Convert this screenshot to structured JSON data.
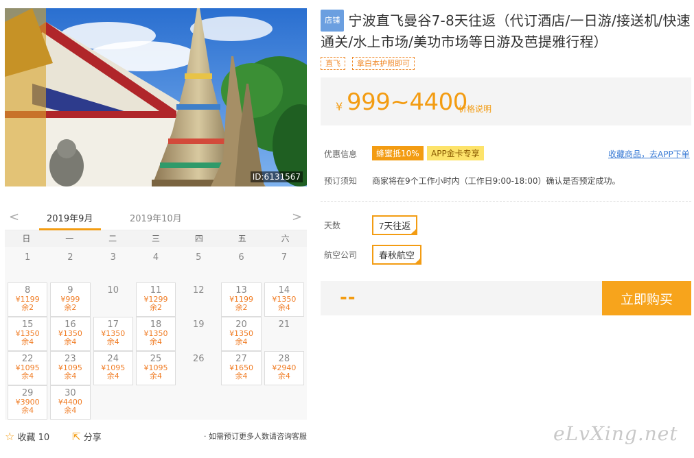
{
  "hero": {
    "photo_id": "ID:6131567"
  },
  "product": {
    "shop_badge": "店铺",
    "title": "宁波直飞曼谷7-8天往返（代订酒店/一日游/接送机/快速通关/水上市场/美功市场等日游及芭提雅行程）",
    "tags": [
      "直飞",
      "拿白本护照即可"
    ],
    "price_symbol": "¥",
    "price_range": "999~4400",
    "price_note": "价格说明"
  },
  "promo": {
    "label": "优惠信息",
    "badge1": "蜂蜜抵10%",
    "badge2": "APP金卡专享",
    "fav_link": "收藏商品，去APP下单"
  },
  "booking_notice": {
    "label": "预订须知",
    "text": "商家将在9个工作小时内（工作日9:00-18:00）确认是否预定成功。"
  },
  "options": {
    "days_label": "天数",
    "days_value": "7天往返",
    "airline_label": "航空公司",
    "airline_value": "春秋航空"
  },
  "buy": {
    "placeholder": "--",
    "button": "立即购买"
  },
  "calendar": {
    "prev": "<",
    "next": ">",
    "months": [
      "2019年9月",
      "2019年10月"
    ],
    "weekdays": [
      "日",
      "一",
      "二",
      "三",
      "四",
      "五",
      "六"
    ],
    "days": [
      {
        "d": "1"
      },
      {
        "d": "2"
      },
      {
        "d": "3"
      },
      {
        "d": "4"
      },
      {
        "d": "5"
      },
      {
        "d": "6"
      },
      {
        "d": "7"
      },
      {
        "d": "8",
        "p": "¥1199",
        "r": "余2"
      },
      {
        "d": "9",
        "p": "¥999",
        "r": "余2"
      },
      {
        "d": "10"
      },
      {
        "d": "11",
        "p": "¥1299",
        "r": "余2"
      },
      {
        "d": "12"
      },
      {
        "d": "13",
        "p": "¥1199",
        "r": "余2"
      },
      {
        "d": "14",
        "p": "¥1350",
        "r": "余4"
      },
      {
        "d": "15",
        "p": "¥1350",
        "r": "余4"
      },
      {
        "d": "16",
        "p": "¥1350",
        "r": "余4"
      },
      {
        "d": "17",
        "p": "¥1350",
        "r": "余4"
      },
      {
        "d": "18",
        "p": "¥1350",
        "r": "余4"
      },
      {
        "d": "19"
      },
      {
        "d": "20",
        "p": "¥1350",
        "r": "余4"
      },
      {
        "d": "21"
      },
      {
        "d": "22",
        "p": "¥1095",
        "r": "余4"
      },
      {
        "d": "23",
        "p": "¥1095",
        "r": "余4"
      },
      {
        "d": "24",
        "p": "¥1095",
        "r": "余4"
      },
      {
        "d": "25",
        "p": "¥1095",
        "r": "余4"
      },
      {
        "d": "26"
      },
      {
        "d": "27",
        "p": "¥1650",
        "r": "余4"
      },
      {
        "d": "28",
        "p": "¥2940",
        "r": "余4"
      },
      {
        "d": "29",
        "p": "¥3900",
        "r": "余4"
      },
      {
        "d": "30",
        "p": "¥4400",
        "r": "余4"
      }
    ]
  },
  "footer": {
    "fav_label": "收藏",
    "fav_count": "10",
    "share_label": "分享",
    "note": "· 如需预订更多人数请咨询客服"
  },
  "watermark": "eLvXing.net",
  "colors": {
    "accent": "#f39c12",
    "link": "#3a7bd5",
    "badge_blue": "#6b9fe0"
  }
}
